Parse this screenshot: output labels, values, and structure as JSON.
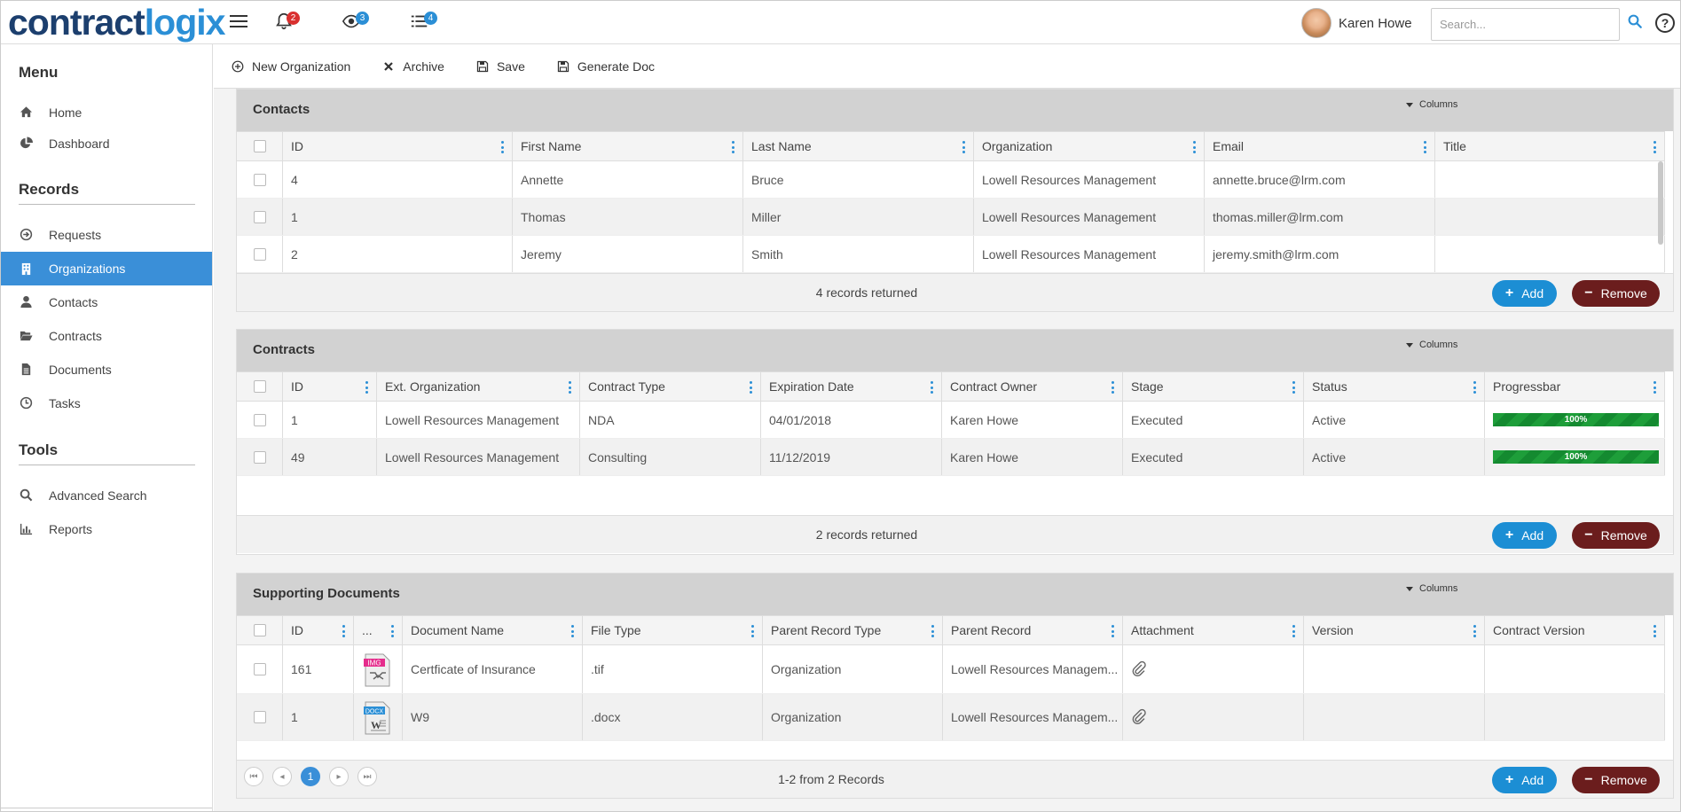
{
  "app": {
    "logo_part1": "contract",
    "logo_part2": "logix",
    "notifications_count": "2",
    "watch_count": "3",
    "tasks_count": "4",
    "user_name": "Karen Howe",
    "search_placeholder": "Search...",
    "help_label": "?"
  },
  "sidebar": {
    "menu_heading": "Menu",
    "menu_items": [
      {
        "label": "Home",
        "icon": "home-icon"
      },
      {
        "label": "Dashboard",
        "icon": "pie-chart-icon"
      }
    ],
    "records_heading": "Records",
    "records_items": [
      {
        "label": "Requests",
        "icon": "arrow-circle-icon"
      },
      {
        "label": "Organizations",
        "icon": "building-icon",
        "active": true
      },
      {
        "label": "Contacts",
        "icon": "user-icon"
      },
      {
        "label": "Contracts",
        "icon": "folder-open-icon"
      },
      {
        "label": "Documents",
        "icon": "document-icon"
      },
      {
        "label": "Tasks",
        "icon": "clock-icon"
      }
    ],
    "tools_heading": "Tools",
    "tools_items": [
      {
        "label": "Advanced Search",
        "icon": "search-icon"
      },
      {
        "label": "Reports",
        "icon": "bar-chart-icon"
      }
    ]
  },
  "toolbar": {
    "new_org": "New Organization",
    "archive": "Archive",
    "save": "Save",
    "generate_doc": "Generate Doc"
  },
  "contacts": {
    "title": "Contacts",
    "columns_label": "Columns",
    "headers": [
      "ID",
      "First Name",
      "Last Name",
      "Organization",
      "Email",
      "Title"
    ],
    "rows": [
      [
        "4",
        "Annette",
        "Bruce",
        "Lowell Resources Management",
        "annette.bruce@lrm.com",
        ""
      ],
      [
        "1",
        "Thomas",
        "Miller",
        "Lowell Resources Management",
        "thomas.miller@lrm.com",
        ""
      ],
      [
        "2",
        "Jeremy",
        "Smith",
        "Lowell Resources Management",
        "jeremy.smith@lrm.com",
        ""
      ]
    ],
    "footer": "4 records returned",
    "add": "Add",
    "remove": "Remove"
  },
  "contracts": {
    "title": "Contracts",
    "columns_label": "Columns",
    "headers": [
      "ID",
      "Ext. Organization",
      "Contract Type",
      "Expiration Date",
      "Contract Owner",
      "Stage",
      "Status",
      "Progressbar"
    ],
    "rows": [
      [
        "1",
        "Lowell Resources Management",
        "NDA",
        "04/01/2018",
        "Karen Howe",
        "Executed",
        "Active",
        "100%"
      ],
      [
        "49",
        "Lowell Resources Management",
        "Consulting",
        "11/12/2019",
        "Karen Howe",
        "Executed",
        "Active",
        "100%"
      ]
    ],
    "footer": "2 records returned",
    "add": "Add",
    "remove": "Remove"
  },
  "documents": {
    "title": "Supporting Documents",
    "columns_label": "Columns",
    "headers": [
      "ID",
      "...",
      "Document Name",
      "File Type",
      "Parent Record Type",
      "Parent Record",
      "Attachment",
      "Version",
      "Contract Version"
    ],
    "rows": [
      [
        "161",
        "IMG",
        "Certficate of Insurance",
        ".tif",
        "Organization",
        "Lowell Resources Managem...",
        "",
        "",
        ""
      ],
      [
        "1",
        "DOCX",
        "W9",
        ".docx",
        "Organization",
        "Lowell Resources Managem...",
        "",
        "",
        ""
      ]
    ],
    "footer": "1-2 from 2 Records",
    "current_page": "1",
    "add": "Add",
    "remove": "Remove"
  },
  "colors": {
    "brand_dark": "#1c3f6e",
    "brand_light": "#2b8fd6",
    "active_nav": "#3a8fd8",
    "add_button": "#1c8ed4",
    "remove_button": "#6b1d1d",
    "progress": "#1e9e3a"
  }
}
